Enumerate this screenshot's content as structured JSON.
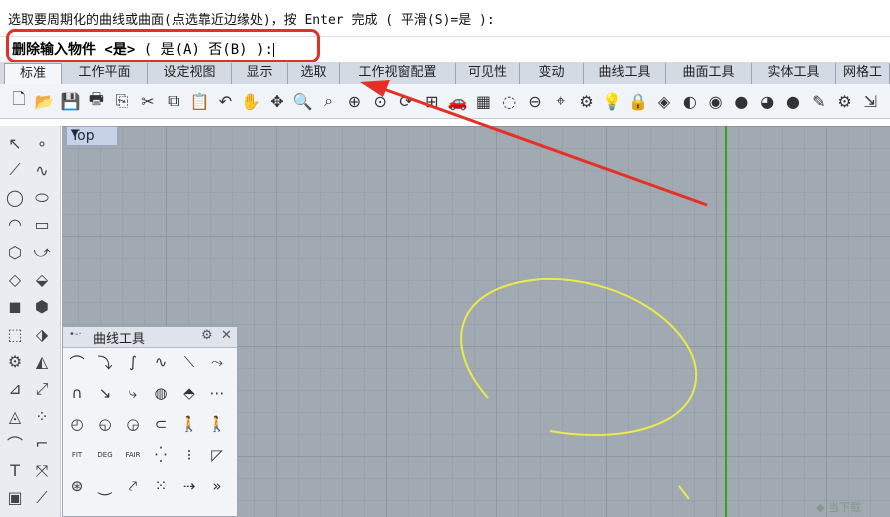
{
  "command": {
    "history_line": "选取要周期化的曲线或曲面(点选靠近边缘处)，按 Enter 完成 ( 平滑(S)=是 ):",
    "prompt_main": "删除输入物件 <是>",
    "prompt_options": " ( 是(A)  否(B) ):"
  },
  "tabs": [
    {
      "label": "标准"
    },
    {
      "label": "工作平面"
    },
    {
      "label": "设定视图"
    },
    {
      "label": "显示"
    },
    {
      "label": "选取"
    },
    {
      "label": "工作视窗配置"
    },
    {
      "label": "可见性"
    },
    {
      "label": "变动"
    },
    {
      "label": "曲线工具"
    },
    {
      "label": "曲面工具"
    },
    {
      "label": "实体工具"
    },
    {
      "label": "网格工"
    }
  ],
  "toolbar_icons": [
    {
      "name": "new-file-icon",
      "glyph": "🗋"
    },
    {
      "name": "open-folder-icon",
      "glyph": "📂"
    },
    {
      "name": "save-icon",
      "glyph": "💾"
    },
    {
      "name": "print-icon",
      "glyph": "🖶"
    },
    {
      "name": "export-icon",
      "glyph": "⎘"
    },
    {
      "name": "cut-icon",
      "glyph": "✂"
    },
    {
      "name": "copy-icon",
      "glyph": "⧉"
    },
    {
      "name": "paste-icon",
      "glyph": "📋"
    },
    {
      "name": "undo-icon",
      "glyph": "↶"
    },
    {
      "name": "pan-hand-icon",
      "glyph": "✋"
    },
    {
      "name": "move-view-icon",
      "glyph": "✥"
    },
    {
      "name": "zoom-icon",
      "glyph": "🔍"
    },
    {
      "name": "zoom-window-icon",
      "glyph": "⌕"
    },
    {
      "name": "zoom-extents-icon",
      "glyph": "⊕"
    },
    {
      "name": "zoom-selected-icon",
      "glyph": "⊙"
    },
    {
      "name": "rotate-view-icon",
      "glyph": "⟳"
    },
    {
      "name": "four-viewports-icon",
      "glyph": "⊞"
    },
    {
      "name": "car-icon",
      "glyph": "🚗"
    },
    {
      "name": "grid-plane-icon",
      "glyph": "▦"
    },
    {
      "name": "select-icon",
      "glyph": "◌"
    },
    {
      "name": "circle-minus-icon",
      "glyph": "⊖"
    },
    {
      "name": "snap-icon",
      "glyph": "⌖"
    },
    {
      "name": "lock-gear-icon",
      "glyph": "⚙"
    },
    {
      "name": "light-bulb-icon",
      "glyph": "💡"
    },
    {
      "name": "lock-icon",
      "glyph": "🔒"
    },
    {
      "name": "layer-icon",
      "glyph": "◈"
    },
    {
      "name": "material-icon",
      "glyph": "◐"
    },
    {
      "name": "color-wheel-icon",
      "glyph": "◉"
    },
    {
      "name": "render-sphere-icon",
      "glyph": "●"
    },
    {
      "name": "render-preview-icon",
      "glyph": "◕"
    },
    {
      "name": "blue-sphere-icon",
      "glyph": "●"
    },
    {
      "name": "pencil-icon",
      "glyph": "✎"
    },
    {
      "name": "settings-icon",
      "glyph": "⚙"
    },
    {
      "name": "layout-icon",
      "glyph": "⇲"
    }
  ],
  "left_panel_icons": [
    {
      "name": "select-arrow-icon",
      "glyph": "↖"
    },
    {
      "name": "point-icon",
      "glyph": "∘"
    },
    {
      "name": "polyline-icon",
      "glyph": "⟋"
    },
    {
      "name": "curve-icon",
      "glyph": "∿"
    },
    {
      "name": "circle-icon",
      "glyph": "◯"
    },
    {
      "name": "ellipse-icon",
      "glyph": "⬭"
    },
    {
      "name": "arc-icon",
      "glyph": "◠"
    },
    {
      "name": "rectangle-icon",
      "glyph": "▭"
    },
    {
      "name": "polygon-icon",
      "glyph": "⬡"
    },
    {
      "name": "curve-tool-icon",
      "glyph": "⤻"
    },
    {
      "name": "surface-icon",
      "glyph": "◇"
    },
    {
      "name": "surface-edit-icon",
      "glyph": "⬙"
    },
    {
      "name": "box-icon",
      "glyph": "◼"
    },
    {
      "name": "solid-icon",
      "glyph": "⬢"
    },
    {
      "name": "mesh-icon",
      "glyph": "⬚"
    },
    {
      "name": "subd-icon",
      "glyph": "⬗"
    },
    {
      "name": "gear-part-icon",
      "glyph": "⚙"
    },
    {
      "name": "boolean-icon",
      "glyph": "◭"
    },
    {
      "name": "analyze-icon",
      "glyph": "⊿"
    },
    {
      "name": "transform-icon",
      "glyph": "⤢"
    },
    {
      "name": "drafting-icon",
      "glyph": "◬"
    },
    {
      "name": "join-icon",
      "glyph": "⁘"
    },
    {
      "name": "dimension-icon",
      "glyph": "⌒"
    },
    {
      "name": "fillet-icon",
      "glyph": "⌐"
    },
    {
      "name": "text-icon",
      "glyph": "T"
    },
    {
      "name": "block-icon",
      "glyph": "⤧"
    },
    {
      "name": "group-icon",
      "glyph": "▣"
    },
    {
      "name": "more-icon",
      "glyph": "⟋"
    }
  ],
  "viewport": {
    "label": "Top",
    "dropdown_glyph": "▼"
  },
  "curve_tools_panel": {
    "title": "曲线工具",
    "icons": [
      {
        "name": "curve-arc-icon",
        "glyph": "⌒"
      },
      {
        "name": "curve-step-icon",
        "glyph": "⤵"
      },
      {
        "name": "curve-s-icon",
        "glyph": "∫"
      },
      {
        "name": "curve-continuity-icon",
        "glyph": "∿"
      },
      {
        "name": "curve-line-icon",
        "glyph": "⟍"
      },
      {
        "name": "curve-dashed-icon",
        "glyph": "⤳"
      },
      {
        "name": "curve-bridge-icon",
        "glyph": "∩"
      },
      {
        "name": "curve-blend-icon",
        "glyph": "↘"
      },
      {
        "name": "curve-fillet-icon",
        "glyph": "⤷"
      },
      {
        "name": "curve-rebuild-icon",
        "glyph": "◍"
      },
      {
        "name": "curve-match-icon",
        "glyph": "⬘"
      },
      {
        "name": "curve-offset-icon",
        "glyph": "⋯"
      },
      {
        "name": "curve-pull-icon",
        "glyph": "◴"
      },
      {
        "name": "curve-extend-icon",
        "glyph": "◵"
      },
      {
        "name": "curve-project-icon",
        "glyph": "◶"
      },
      {
        "name": "curve-control-icon",
        "glyph": "⊂"
      },
      {
        "name": "curve-person-icon",
        "glyph": "🚶"
      },
      {
        "name": "curve-person-two-icon",
        "glyph": "🚶"
      },
      {
        "name": "fit-curve-icon",
        "glyph": "FIT"
      },
      {
        "name": "deg-curve-icon",
        "glyph": "DEG"
      },
      {
        "name": "fair-curve-icon",
        "glyph": "FAIR"
      },
      {
        "name": "curve-points-icon",
        "glyph": "⁛"
      },
      {
        "name": "curve-nodes-icon",
        "glyph": "⁝"
      },
      {
        "name": "curve-shape-icon",
        "glyph": "◸"
      },
      {
        "name": "curve-pivot-icon",
        "glyph": "⊛"
      },
      {
        "name": "curve-wave-icon",
        "glyph": "⏝"
      },
      {
        "name": "curve-polyline-icon",
        "glyph": "⤤"
      },
      {
        "name": "curve-delete-point-icon",
        "glyph": "⁙"
      },
      {
        "name": "curve-move-point-icon",
        "glyph": "⇢"
      },
      {
        "name": "curve-more-icon",
        "glyph": "»"
      }
    ]
  },
  "colors": {
    "annotation_red": "#e53125",
    "curve_yellow": "#eaea4a",
    "axis_green": "#2fa51a",
    "viewport_bg": "#a1a9b3"
  }
}
